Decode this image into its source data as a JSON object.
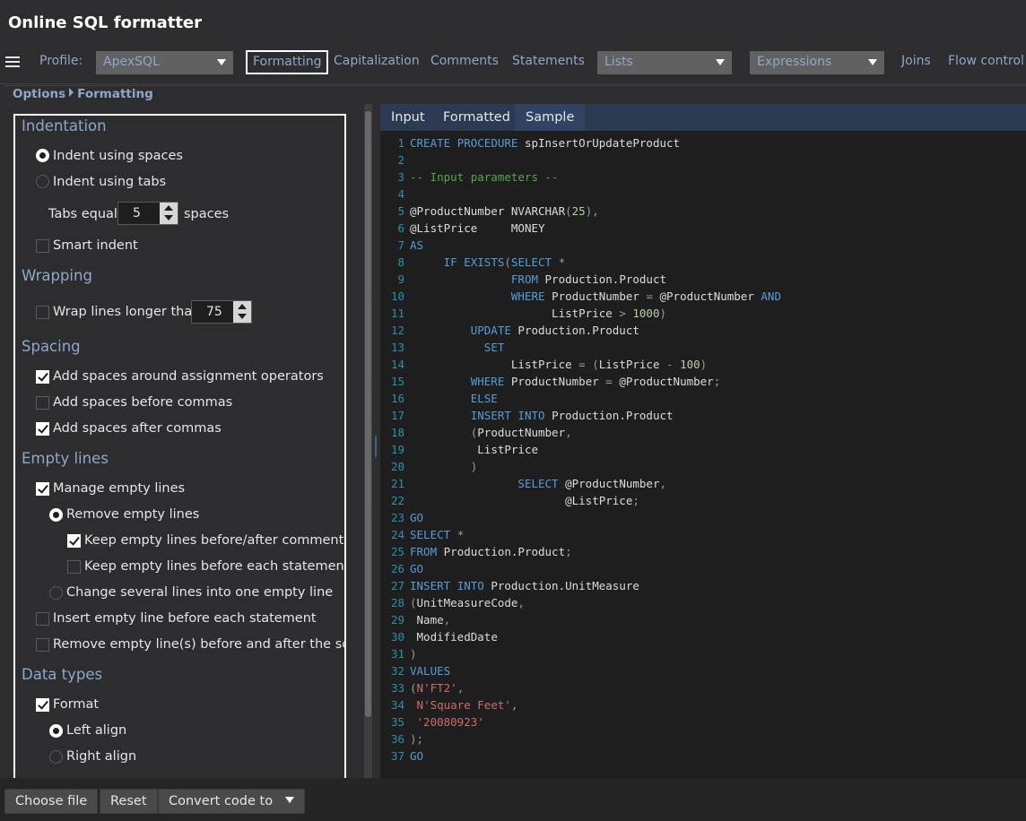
{
  "app": {
    "title": "Online SQL formatter"
  },
  "toolbar": {
    "profile_label": "Profile:",
    "profile_value": "ApexSQL",
    "tabs": [
      {
        "label": "Formatting",
        "active": true
      },
      {
        "label": "Capitalization"
      },
      {
        "label": "Comments"
      },
      {
        "label": "Statements"
      },
      {
        "label": "Lists",
        "dropdown": true
      },
      {
        "label": "Expressions",
        "dropdown": true
      },
      {
        "label": "Joins"
      },
      {
        "label": "Flow control"
      }
    ]
  },
  "breadcrumb": {
    "root": "Options",
    "current": "Formatting"
  },
  "options": {
    "indentation": {
      "heading": "Indentation",
      "spaces_label": "Indent using spaces",
      "spaces_selected": true,
      "tabs_label": "Indent using tabs",
      "tabs_selected": false,
      "tabs_equal_label": "Tabs equal",
      "tabs_equal_value": "5",
      "tabs_equal_unit": "spaces",
      "smart_indent_label": "Smart indent",
      "smart_indent_checked": false
    },
    "wrapping": {
      "heading": "Wrapping",
      "wrap_label": "Wrap lines longer than",
      "wrap_checked": false,
      "wrap_value": "75"
    },
    "spacing": {
      "heading": "Spacing",
      "assignment_label": "Add spaces around assignment operators",
      "assignment_checked": true,
      "before_commas_label": "Add spaces before commas",
      "before_commas_checked": false,
      "after_commas_label": "Add spaces after commas",
      "after_commas_checked": true
    },
    "empty_lines": {
      "heading": "Empty lines",
      "manage_label": "Manage empty lines",
      "manage_checked": true,
      "remove_label": "Remove empty lines",
      "remove_selected": true,
      "keep_comments_label": "Keep empty lines before/after comments",
      "keep_comments_checked": true,
      "keep_statement_label": "Keep empty lines before each statement",
      "keep_statement_checked": false,
      "change_label": "Change several lines into one empty line",
      "change_selected": false,
      "insert_label": "Insert empty line before each statement",
      "insert_checked": false,
      "remove_script_label": "Remove empty line(s) before and after the script",
      "remove_script_checked": false
    },
    "data_types": {
      "heading": "Data types",
      "format_label": "Format",
      "format_checked": true,
      "left_label": "Left align",
      "left_selected": true,
      "right_label": "Right align",
      "right_selected": false
    }
  },
  "editor": {
    "tabs": [
      {
        "label": "Input"
      },
      {
        "label": "Formatted"
      },
      {
        "label": "Sample",
        "active": true
      }
    ],
    "lines": [
      "1",
      "2",
      "3",
      "4",
      "5",
      "6",
      "7",
      "8",
      "9",
      "10",
      "11",
      "12",
      "13",
      "14",
      "15",
      "16",
      "17",
      "18",
      "19",
      "20",
      "21",
      "22",
      "23",
      "24",
      "25",
      "26",
      "27",
      "28",
      "29",
      "30",
      "31",
      "32",
      "33",
      "34",
      "35",
      "36",
      "37"
    ],
    "code": {
      "t_create": "CREATE",
      "t_procedure": "PROCEDURE",
      "t_procname": "spInsertOrUpdateProduct",
      "t_comment": "-- Input parameters --",
      "t_pnum": "@ProductNumber",
      "t_nvarchar": "NVARCHAR",
      "t_open": "(",
      "t_25": "25",
      "t_close_comma": "),",
      "t_plist": "@ListPrice",
      "t_money": "MONEY",
      "t_as": "AS",
      "t_if": "IF",
      "t_exists": "EXISTS",
      "t_select": "SELECT",
      "t_star": "*",
      "t_from": "FROM",
      "t_prodprod": "Production.Product",
      "t_where": "WHERE",
      "t_productnumber": "ProductNumber",
      "t_eq": "=",
      "t_and": "AND",
      "t_listprice": "ListPrice",
      "t_gt": ">",
      "t_1000": "1000",
      "t_close": ")",
      "t_update": "UPDATE",
      "t_set": "SET",
      "t_minus": "-",
      "t_100": "100",
      "t_semicolon": ";",
      "t_else": "ELSE",
      "t_insert": "INSERT",
      "t_into": "INTO",
      "t_comma": ",",
      "t_go": "GO",
      "t_unitmeasure": "Production.UnitMeasure",
      "t_umc": "UnitMeasureCode",
      "t_name": "Name",
      "t_modified": "ModifiedDate",
      "t_values": "VALUES",
      "t_n": "N",
      "t_ft2": "'FT2'",
      "t_sqft": "'Square Feet'",
      "t_date": "'20080923'",
      "t_close_semi": ");"
    }
  },
  "bottom": {
    "choose_file": "Choose file",
    "reset": "Reset",
    "convert": "Convert code to"
  }
}
